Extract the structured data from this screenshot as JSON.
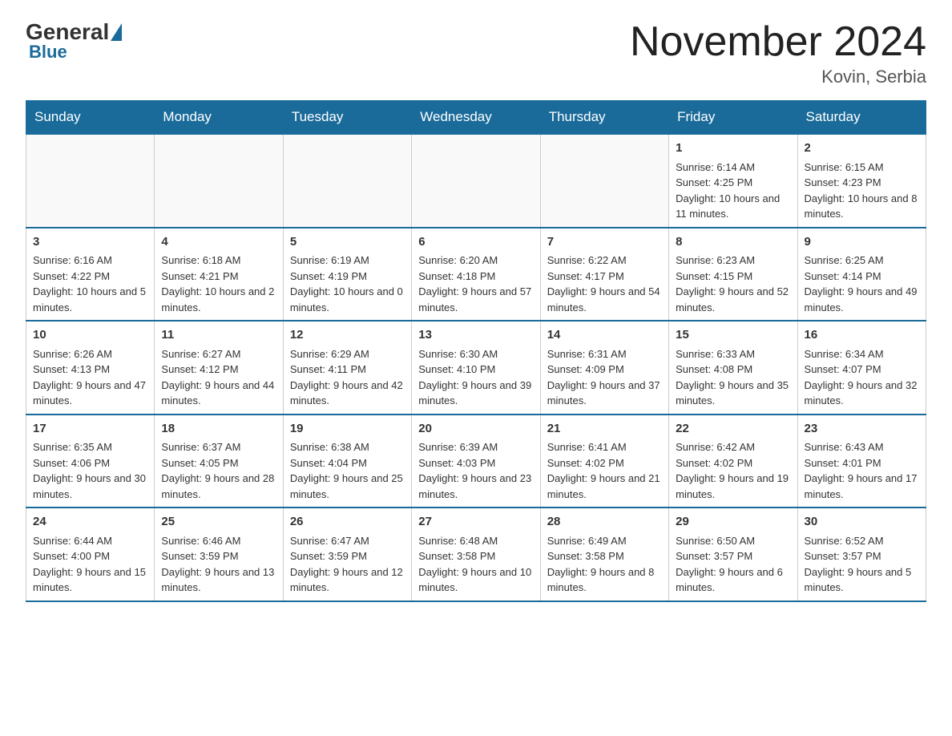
{
  "logo": {
    "general": "General",
    "blue": "Blue"
  },
  "title": "November 2024",
  "location": "Kovin, Serbia",
  "days_of_week": [
    "Sunday",
    "Monday",
    "Tuesday",
    "Wednesday",
    "Thursday",
    "Friday",
    "Saturday"
  ],
  "weeks": [
    [
      {
        "day": "",
        "info": ""
      },
      {
        "day": "",
        "info": ""
      },
      {
        "day": "",
        "info": ""
      },
      {
        "day": "",
        "info": ""
      },
      {
        "day": "",
        "info": ""
      },
      {
        "day": "1",
        "info": "Sunrise: 6:14 AM\nSunset: 4:25 PM\nDaylight: 10 hours and 11 minutes."
      },
      {
        "day": "2",
        "info": "Sunrise: 6:15 AM\nSunset: 4:23 PM\nDaylight: 10 hours and 8 minutes."
      }
    ],
    [
      {
        "day": "3",
        "info": "Sunrise: 6:16 AM\nSunset: 4:22 PM\nDaylight: 10 hours and 5 minutes."
      },
      {
        "day": "4",
        "info": "Sunrise: 6:18 AM\nSunset: 4:21 PM\nDaylight: 10 hours and 2 minutes."
      },
      {
        "day": "5",
        "info": "Sunrise: 6:19 AM\nSunset: 4:19 PM\nDaylight: 10 hours and 0 minutes."
      },
      {
        "day": "6",
        "info": "Sunrise: 6:20 AM\nSunset: 4:18 PM\nDaylight: 9 hours and 57 minutes."
      },
      {
        "day": "7",
        "info": "Sunrise: 6:22 AM\nSunset: 4:17 PM\nDaylight: 9 hours and 54 minutes."
      },
      {
        "day": "8",
        "info": "Sunrise: 6:23 AM\nSunset: 4:15 PM\nDaylight: 9 hours and 52 minutes."
      },
      {
        "day": "9",
        "info": "Sunrise: 6:25 AM\nSunset: 4:14 PM\nDaylight: 9 hours and 49 minutes."
      }
    ],
    [
      {
        "day": "10",
        "info": "Sunrise: 6:26 AM\nSunset: 4:13 PM\nDaylight: 9 hours and 47 minutes."
      },
      {
        "day": "11",
        "info": "Sunrise: 6:27 AM\nSunset: 4:12 PM\nDaylight: 9 hours and 44 minutes."
      },
      {
        "day": "12",
        "info": "Sunrise: 6:29 AM\nSunset: 4:11 PM\nDaylight: 9 hours and 42 minutes."
      },
      {
        "day": "13",
        "info": "Sunrise: 6:30 AM\nSunset: 4:10 PM\nDaylight: 9 hours and 39 minutes."
      },
      {
        "day": "14",
        "info": "Sunrise: 6:31 AM\nSunset: 4:09 PM\nDaylight: 9 hours and 37 minutes."
      },
      {
        "day": "15",
        "info": "Sunrise: 6:33 AM\nSunset: 4:08 PM\nDaylight: 9 hours and 35 minutes."
      },
      {
        "day": "16",
        "info": "Sunrise: 6:34 AM\nSunset: 4:07 PM\nDaylight: 9 hours and 32 minutes."
      }
    ],
    [
      {
        "day": "17",
        "info": "Sunrise: 6:35 AM\nSunset: 4:06 PM\nDaylight: 9 hours and 30 minutes."
      },
      {
        "day": "18",
        "info": "Sunrise: 6:37 AM\nSunset: 4:05 PM\nDaylight: 9 hours and 28 minutes."
      },
      {
        "day": "19",
        "info": "Sunrise: 6:38 AM\nSunset: 4:04 PM\nDaylight: 9 hours and 25 minutes."
      },
      {
        "day": "20",
        "info": "Sunrise: 6:39 AM\nSunset: 4:03 PM\nDaylight: 9 hours and 23 minutes."
      },
      {
        "day": "21",
        "info": "Sunrise: 6:41 AM\nSunset: 4:02 PM\nDaylight: 9 hours and 21 minutes."
      },
      {
        "day": "22",
        "info": "Sunrise: 6:42 AM\nSunset: 4:02 PM\nDaylight: 9 hours and 19 minutes."
      },
      {
        "day": "23",
        "info": "Sunrise: 6:43 AM\nSunset: 4:01 PM\nDaylight: 9 hours and 17 minutes."
      }
    ],
    [
      {
        "day": "24",
        "info": "Sunrise: 6:44 AM\nSunset: 4:00 PM\nDaylight: 9 hours and 15 minutes."
      },
      {
        "day": "25",
        "info": "Sunrise: 6:46 AM\nSunset: 3:59 PM\nDaylight: 9 hours and 13 minutes."
      },
      {
        "day": "26",
        "info": "Sunrise: 6:47 AM\nSunset: 3:59 PM\nDaylight: 9 hours and 12 minutes."
      },
      {
        "day": "27",
        "info": "Sunrise: 6:48 AM\nSunset: 3:58 PM\nDaylight: 9 hours and 10 minutes."
      },
      {
        "day": "28",
        "info": "Sunrise: 6:49 AM\nSunset: 3:58 PM\nDaylight: 9 hours and 8 minutes."
      },
      {
        "day": "29",
        "info": "Sunrise: 6:50 AM\nSunset: 3:57 PM\nDaylight: 9 hours and 6 minutes."
      },
      {
        "day": "30",
        "info": "Sunrise: 6:52 AM\nSunset: 3:57 PM\nDaylight: 9 hours and 5 minutes."
      }
    ]
  ]
}
